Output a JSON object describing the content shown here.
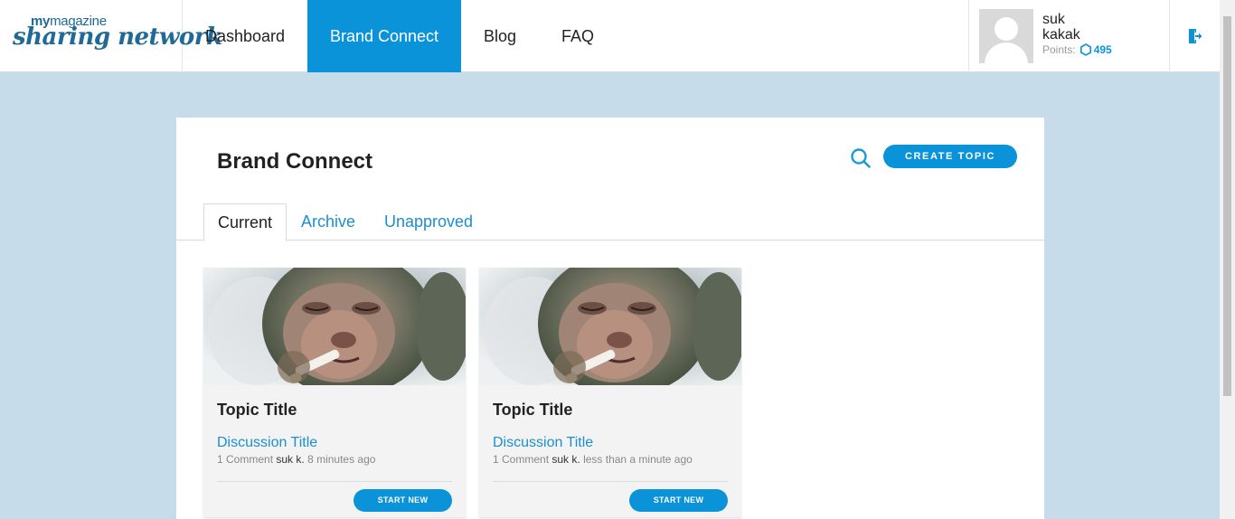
{
  "brand": {
    "logo_top_bold": "my",
    "logo_top_light": "magazine",
    "logo_main": "sharing network"
  },
  "nav": {
    "items": [
      {
        "label": "Dashboard"
      },
      {
        "label": "Brand Connect"
      },
      {
        "label": "Blog"
      },
      {
        "label": "FAQ"
      }
    ],
    "active": "Brand Connect"
  },
  "user": {
    "first_name": "suk",
    "last_name": "kakak",
    "points_label": "Points:",
    "points_value": "495"
  },
  "icons": {
    "logout": "logout-icon",
    "search": "search-icon",
    "points": "hexagon-icon",
    "avatar": "user-placeholder-icon"
  },
  "colors": {
    "accent": "#0a93d8",
    "link": "#1b8fcf",
    "background": "#c6dcea"
  },
  "page": {
    "title": "Brand Connect",
    "create_topic_label": "CREATE TOPIC",
    "tabs": [
      {
        "label": "Current"
      },
      {
        "label": "Archive"
      },
      {
        "label": "Unapproved"
      }
    ],
    "active_tab": "Current"
  },
  "cards": [
    {
      "topic_title": "Topic Title",
      "discussion_title": "Discussion Title",
      "comment_count": "1 Comment",
      "author": "suk k.",
      "time": "8 minutes ago",
      "button_label": "START NEW"
    },
    {
      "topic_title": "Topic Title",
      "discussion_title": "Discussion Title",
      "comment_count": "1 Comment",
      "author": "suk k.",
      "time": "less than a minute ago",
      "button_label": "START NEW"
    }
  ]
}
